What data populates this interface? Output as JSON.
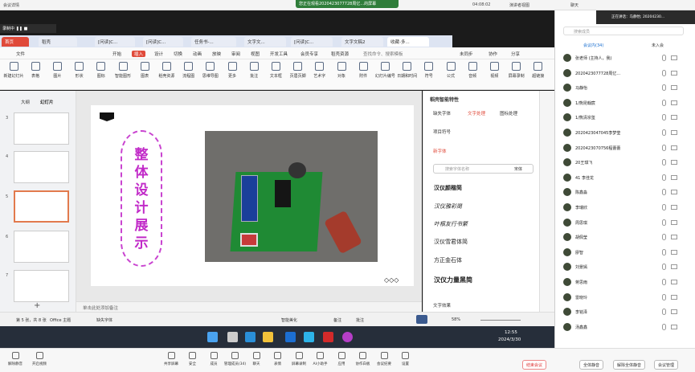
{
  "top_left_app": "会议详情",
  "sharing_banner": "您正在观看2020423077728周亿...的屏幕",
  "meeting_timer": "04:08:02",
  "speaker_view": "演讲者视图",
  "chat_label": "聊天",
  "rec_label": "录制中",
  "tabs": [
    "首页",
    "稻壳",
    "[问读]C...",
    "[问读]C...",
    "任务书-...",
    "文字文...",
    "[问读]C...",
    "文字文稿2",
    "收藏-多..."
  ],
  "menu": [
    "文件",
    "开始",
    "插入",
    "设计",
    "切换",
    "动画",
    "放映",
    "审阅",
    "视图",
    "开发工具",
    "会员专享",
    "稻壳资源"
  ],
  "menu_search": "查找命令、搜索模板",
  "menu_right": [
    "未同步",
    "协作",
    "分享"
  ],
  "tools": [
    "新建幻灯片",
    "表格",
    "图片",
    "形状",
    "图标",
    "智能图形",
    "图表",
    "稻壳资源",
    "流程图",
    "思维导图",
    "更多",
    "批注",
    "文本框",
    "页眉页脚",
    "艺术字",
    "对象",
    "附件",
    "幻灯片编号",
    "日期和时间",
    "符号",
    "公式",
    "音频",
    "视频",
    "屏幕录制",
    "超链接"
  ],
  "left_tabs": [
    "大纲",
    "幻灯片"
  ],
  "slide_numbers": [
    "3",
    "4",
    "5",
    "6",
    "7"
  ],
  "slide_title_chars": [
    "整",
    "体",
    "设",
    "计",
    "展",
    "示"
  ],
  "notes_placeholder": "单击此处添加备注",
  "panel": {
    "header": "稻壳智能特性",
    "tabs": [
      "缺失字体",
      "文字处理",
      "图标处理"
    ],
    "section_1": "项目符号",
    "section_2": "新字体",
    "search_placeholder": "搜索字体名称",
    "search_scope": "宋体",
    "fonts": [
      "汉仪颜楷简",
      "汉仪雅彩简",
      "叶根友行书繁",
      "汉仪雪君体简",
      "方正金石体",
      "汉仪力量黑简"
    ],
    "section_3": "文字效果"
  },
  "status": {
    "left": "第 5 张，共 8 张",
    "theme": "Office 主题",
    "missing_font": "缺失字体",
    "smart_beautify": "智能美化",
    "notes": "备注",
    "comments": "批注",
    "zoom": "58%"
  },
  "taskbar": {
    "time": "12:55",
    "date": "2024/3/30"
  },
  "sidepanel": {
    "search_placeholder": "搜索成员",
    "viewing_label": "正在讲话：马静怡; 20204230...",
    "tabs": [
      "会议内(34)",
      "未入会"
    ],
    "members": [
      "张老师 (主持人，我)",
      "2020423077728周亿...",
      "马静怡",
      "1/熊昆翰宸",
      "1/熊清宗玺",
      "2020423047045李梦莹",
      "2020423070756程蕾蕾",
      "20王琪飞",
      "41 李佳龙",
      "陈鑫淼",
      "李瑞欣",
      "周思琪",
      "胡佩莹",
      "廖智",
      "刘景嫣",
      "蒋思雨",
      "雷晓玲",
      "李铭泽",
      "汤鑫鑫"
    ],
    "bottom_buttons": [
      "全体静音",
      "解除全体静音",
      "会议管理"
    ]
  },
  "meeting_bar": {
    "left": [
      "解除静音",
      "开启视频"
    ],
    "center": [
      "共享屏幕",
      "安全",
      "成员",
      "管理成员(34)",
      "聊天",
      "表情",
      "屏幕录制",
      "AI小助手",
      "应用",
      "协作白板",
      "会议纪要",
      "设置"
    ],
    "end_button": "结束会议"
  },
  "colors": {
    "accent": "#c12ac8",
    "pcb": "#1f8a34",
    "brand": "#e04a3a"
  }
}
